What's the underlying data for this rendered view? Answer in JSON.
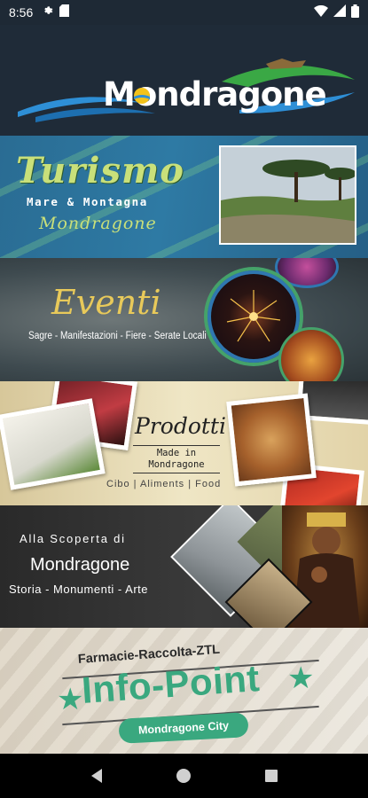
{
  "status_bar": {
    "time": "8:56",
    "icons": [
      "gear-icon",
      "sim-card-icon",
      "wifi-icon",
      "signal-icon",
      "battery-icon"
    ]
  },
  "header": {
    "logo_text": "Mondragone"
  },
  "banners": [
    {
      "title": "Turismo",
      "subtitle": "Mare & Montagna",
      "tagline": "Mondragone"
    },
    {
      "title": "Eventi",
      "subtitle": "Sagre - Manifestazioni - Fiere - Serate Locali"
    },
    {
      "title": "Prodotti",
      "made_line1": "Made in",
      "made_line2": "Mondragone",
      "categories": "Cibo | Aliments | Food"
    },
    {
      "line1": "Alla Scoperta di",
      "line2": "Mondragone",
      "line3": "Storia - Monumenti - Arte"
    },
    {
      "top": "Farmacie-Raccolta-ZTL",
      "title": "Info-Point",
      "badge": "Mondragone City"
    }
  ],
  "colors": {
    "header_bg": "#1f2b38",
    "accent_green": "#3aa87f",
    "accent_blue": "#2f77b0"
  },
  "nav_bar": {
    "buttons": [
      "back-icon",
      "home-icon",
      "recents-icon"
    ]
  }
}
